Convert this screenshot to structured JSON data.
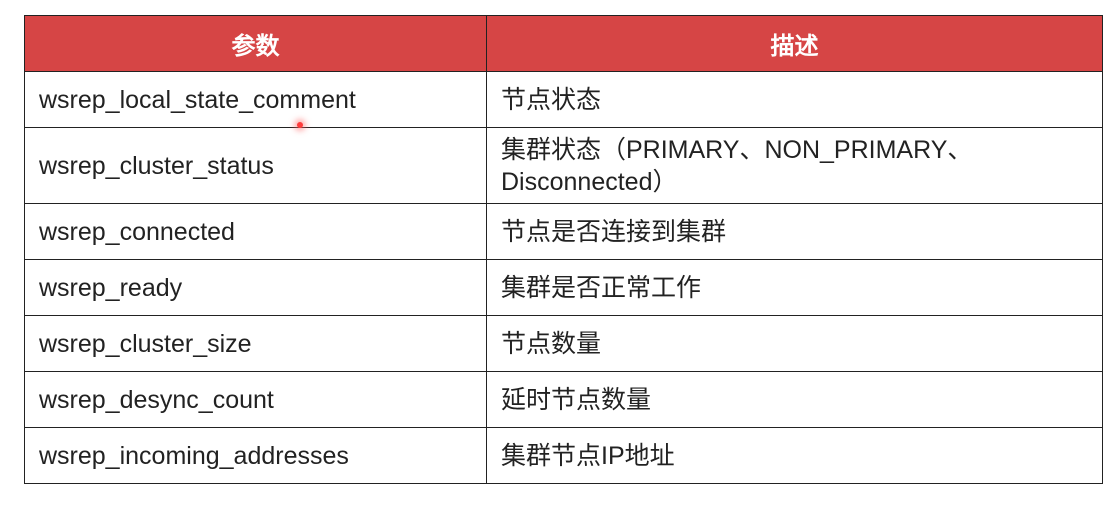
{
  "table": {
    "headers": {
      "param": "参数",
      "desc": "描述"
    },
    "rows": [
      {
        "param": "wsrep_local_state_comment",
        "desc": "节点状态"
      },
      {
        "param": "wsrep_cluster_status",
        "desc": "集群状态（PRIMARY、NON_PRIMARY、Disconnected）"
      },
      {
        "param": "wsrep_connected",
        "desc": "节点是否连接到集群"
      },
      {
        "param": "wsrep_ready",
        "desc": "集群是否正常工作"
      },
      {
        "param": "wsrep_cluster_size",
        "desc": "节点数量"
      },
      {
        "param": "wsrep_desync_count",
        "desc": "延时节点数量"
      },
      {
        "param": "wsrep_incoming_addresses",
        "desc": "集群节点IP地址"
      }
    ]
  },
  "colors": {
    "header_bg": "#d64545",
    "header_text": "#ffffff",
    "border": "#222222",
    "cursor": "#ff3b3b"
  }
}
